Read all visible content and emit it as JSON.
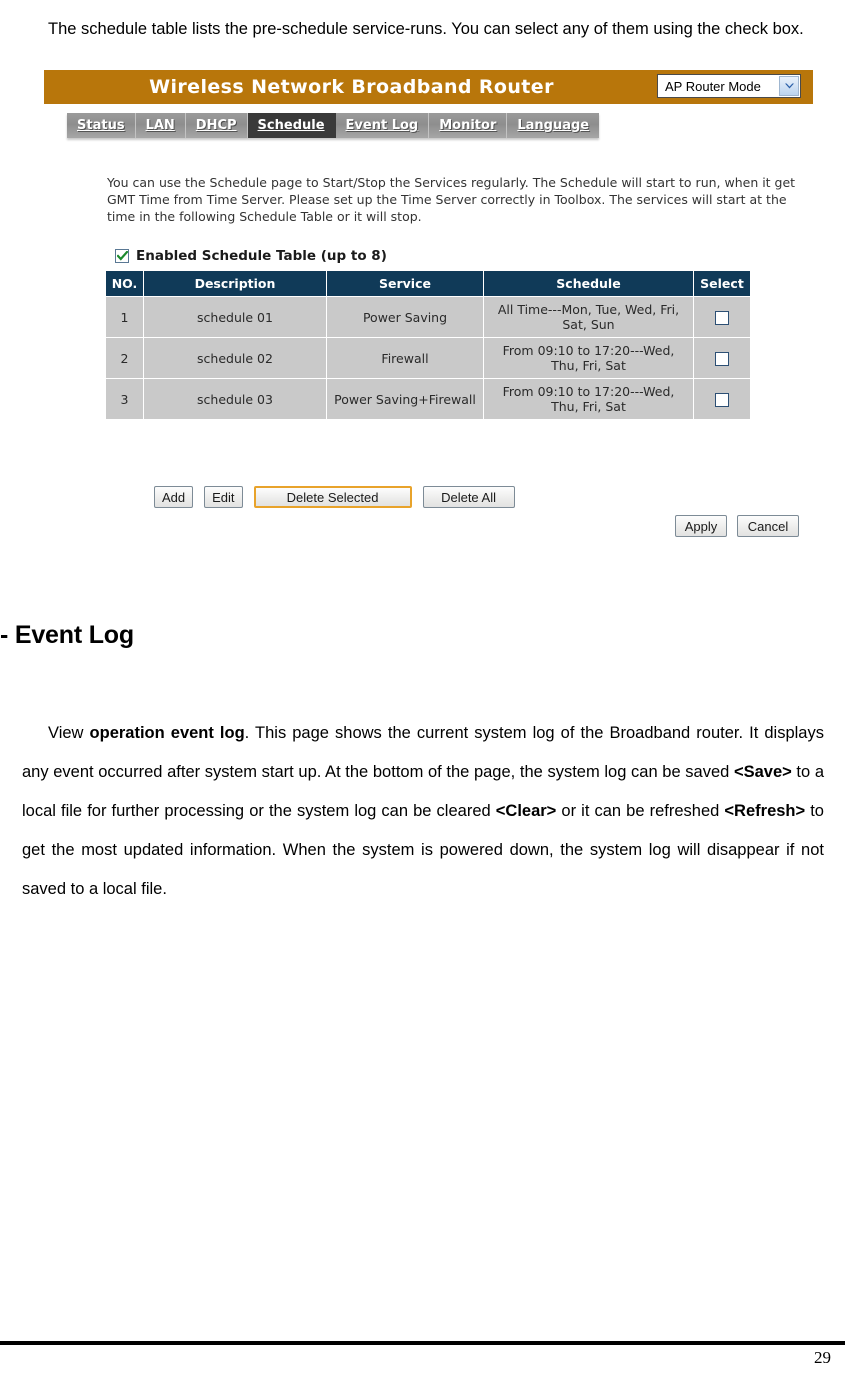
{
  "document": {
    "intro_paragraph": "The schedule table lists the pre-schedule service-runs. You can select any of them using the check box.",
    "section_heading": "- Event Log",
    "eventlog_paragraph_parts": [
      {
        "text": "View ",
        "bold": false
      },
      {
        "text": "operation event log",
        "bold": true
      },
      {
        "text": ". This page shows the current system log of the Broadband router. It displays any event occurred after system start up. At the bottom of the page, the system log can be saved ",
        "bold": false
      },
      {
        "text": "<Save>",
        "bold": true
      },
      {
        "text": " to a local file for further processing or the system log can be cleared ",
        "bold": false
      },
      {
        "text": "<Clear>",
        "bold": true
      },
      {
        "text": " or it can be refreshed ",
        "bold": false
      },
      {
        "text": "<Refresh>",
        "bold": true
      },
      {
        "text": " to get the most updated information. When the system is powered down, the system log will disappear if not saved to a local file.",
        "bold": false
      }
    ],
    "page_number": "29"
  },
  "router_ui": {
    "title": "Wireless Network Broadband Router",
    "mode_select": {
      "value": "AP Router Mode",
      "icon": "chevron-down-icon"
    },
    "nav_items": [
      {
        "label": "Status",
        "active": false
      },
      {
        "label": "LAN",
        "active": false
      },
      {
        "label": "DHCP",
        "active": false
      },
      {
        "label": "Schedule",
        "active": true
      },
      {
        "label": "Event Log",
        "active": false
      },
      {
        "label": "Monitor",
        "active": false
      },
      {
        "label": "Language",
        "active": false
      }
    ],
    "description": "You can use the Schedule page to Start/Stop the Services regularly. The Schedule will start to run, when it get GMT Time from Time Server. Please set up the Time Server correctly in Toolbox. The services will start at the time in the following Schedule Table or it will stop.",
    "enabled_table": {
      "checked": true,
      "label": "Enabled Schedule Table (up to 8)",
      "icon": "check-icon"
    },
    "table": {
      "headers": [
        "NO.",
        "Description",
        "Service",
        "Schedule",
        "Select"
      ],
      "rows": [
        {
          "no": "1",
          "description": "schedule 01",
          "service": "Power Saving",
          "schedule": "All Time---Mon, Tue, Wed, Fri, Sat, Sun",
          "selected": false
        },
        {
          "no": "2",
          "description": "schedule 02",
          "service": "Firewall",
          "schedule": "From 09:10 to 17:20---Wed, Thu, Fri, Sat",
          "selected": false
        },
        {
          "no": "3",
          "description": "schedule 03",
          "service": "Power Saving+Firewall",
          "schedule": "From 09:10 to 17:20---Wed, Thu, Fri, Sat",
          "selected": false
        }
      ]
    },
    "buttons": {
      "add": "Add",
      "edit": "Edit",
      "delete_selected": "Delete Selected",
      "delete_all": "Delete All",
      "apply": "Apply",
      "cancel": "Cancel"
    },
    "colors": {
      "titlebar": "#b8760b",
      "nav_active": "#3a3a3a",
      "table_header": "#103a58",
      "table_row": "#c9c9c9",
      "focus_border": "#e8a32b",
      "check_green": "#1c8a2e"
    }
  }
}
